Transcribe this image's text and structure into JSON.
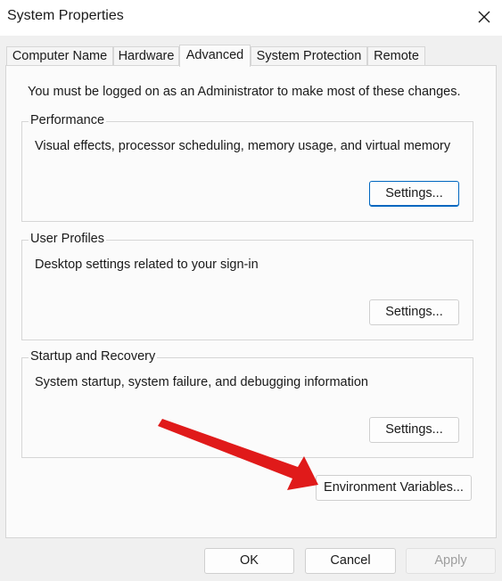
{
  "window": {
    "title": "System Properties"
  },
  "tabs": [
    {
      "label": "Computer Name",
      "active": false
    },
    {
      "label": "Hardware",
      "active": false
    },
    {
      "label": "Advanced",
      "active": true
    },
    {
      "label": "System Protection",
      "active": false
    },
    {
      "label": "Remote",
      "active": false
    }
  ],
  "advanced": {
    "admin_note": "You must be logged on as an Administrator to make most of these changes.",
    "performance": {
      "title": "Performance",
      "description": "Visual effects, processor scheduling, memory usage, and virtual memory",
      "button": "Settings..."
    },
    "user_profiles": {
      "title": "User Profiles",
      "description": "Desktop settings related to your sign-in",
      "button": "Settings..."
    },
    "startup_recovery": {
      "title": "Startup and Recovery",
      "description": "System startup, system failure, and debugging information",
      "button": "Settings..."
    },
    "env_button": "Environment Variables..."
  },
  "footer": {
    "ok": "OK",
    "cancel": "Cancel",
    "apply": "Apply"
  },
  "colors": {
    "accent": "#0067c0",
    "annotation_arrow": "#e01a1a"
  }
}
